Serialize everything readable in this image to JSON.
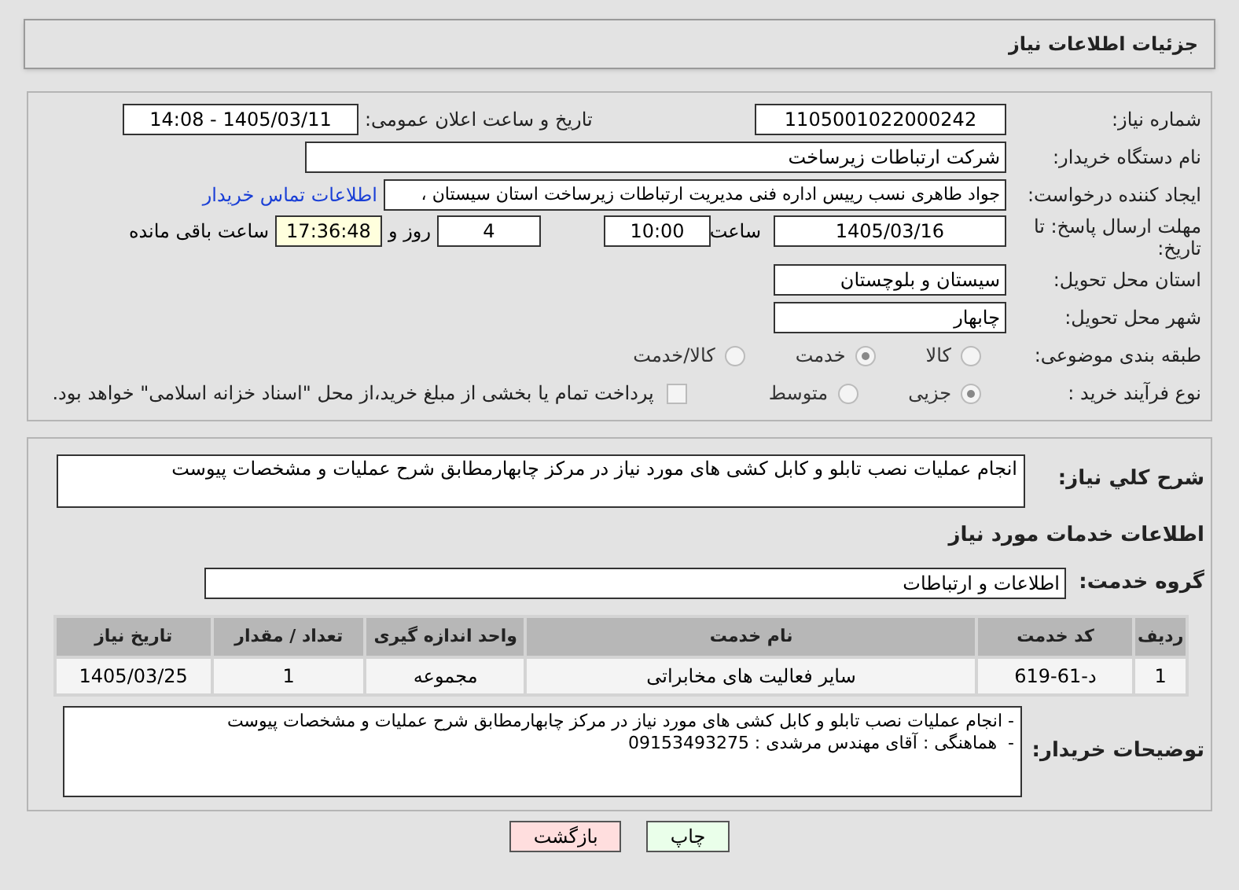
{
  "header": {
    "title": "جزئیات اطلاعات نیاز"
  },
  "need_number": {
    "label": "شماره نیاز:",
    "value": "1105001022000242"
  },
  "announce": {
    "label": "تاریخ و ساعت اعلان عمومی:",
    "value": "1405/03/11 - 14:08"
  },
  "buyer_org": {
    "label": "نام دستگاه خریدار:",
    "value": "شرکت ارتباطات زیرساخت"
  },
  "requester": {
    "label": "ایجاد کننده درخواست:",
    "value": "جواد طاهری نسب رییس اداره فنی مدیریت ارتباطات زیرساخت استان سیستان ،",
    "link": "اطلاعات تماس خریدار"
  },
  "deadline": {
    "label": "مهلت ارسال پاسخ: تا تاریخ:",
    "date": "1405/03/16",
    "time_label": "ساعت",
    "time": "10:00",
    "days": "4",
    "days_label": "روز و",
    "remaining": "17:36:48",
    "remaining_label": "ساعت باقی مانده"
  },
  "province": {
    "label": "استان محل تحویل:",
    "value": "سیستان و بلوچستان"
  },
  "city": {
    "label": "شهر محل تحویل:",
    "value": "چابهار"
  },
  "category": {
    "label": "طبقه بندی موضوعی:",
    "options": [
      {
        "label": "کالا",
        "selected": false
      },
      {
        "label": "خدمت",
        "selected": true
      },
      {
        "label": "کالا/خدمت",
        "selected": false
      }
    ]
  },
  "process": {
    "label": "نوع فرآیند خرید :",
    "options": [
      {
        "label": "جزیی",
        "selected": true
      },
      {
        "label": "متوسط",
        "selected": false
      }
    ],
    "payment": {
      "checked": false,
      "text": "پرداخت تمام یا بخشی از مبلغ خرید،از محل \"اسناد خزانه اسلامی\" خواهد بود."
    }
  },
  "description": {
    "label": "شرح کلي نياز:",
    "value": "انجام عملیات نصب تابلو و کابل کشی های مورد نیاز در مرکز چابهارمطابق شرح عملیات و مشخصات پیوست"
  },
  "services_title": "اطلاعات خدمات مورد نیاز",
  "service_group": {
    "label": "گروه خدمت:",
    "value": "اطلاعات و ارتباطات"
  },
  "table": {
    "columns": [
      "ردیف",
      "کد خدمت",
      "نام خدمت",
      "واحد اندازه گیری",
      "تعداد / مقدار",
      "تاریخ نیاز"
    ],
    "rows": [
      [
        "1",
        "د-61-619",
        "سایر فعالیت های مخابراتی",
        "مجموعه",
        "1",
        "1405/03/25"
      ]
    ]
  },
  "buyer_notes": {
    "label": "توضیحات خریدار:",
    "lines": [
      "- انجام عملیات نصب تابلو و کابل کشی های مورد نیاز در مرکز چابهارمطابق شرح عملیات و مشخصات پیوست",
      "-  هماهنگی : آقای مهندس مرشدی : 09153493275"
    ]
  },
  "buttons": [
    {
      "label": "چاپ",
      "kind": "print"
    },
    {
      "label": "بازگشت",
      "kind": "back"
    }
  ]
}
